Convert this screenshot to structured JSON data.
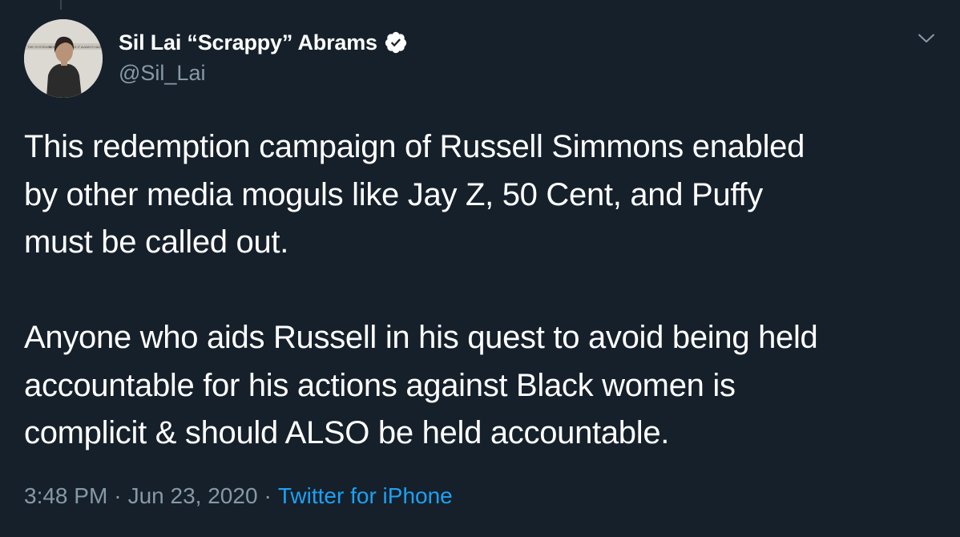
{
  "author": {
    "display_name": "Sil Lai “Scrappy” Abrams",
    "handle": "@Sil_Lai",
    "verified": true,
    "avatar_icon": "profile-photo"
  },
  "tweet": {
    "text": "This redemption campaign of Russell Simmons enabled\nby other media moguls like Jay Z, 50 Cent, and Puffy\nmust be called out.\n\nAnyone who aids Russell in his quest to avoid being held\naccountable for his actions against Black women is\ncomplicit & should ALSO be held accountable.",
    "time": "3:48 PM",
    "separator": "·",
    "date": "Jun 23, 2020",
    "source": "Twitter for iPhone"
  },
  "icons": {
    "verified": "verified-badge-icon",
    "menu": "chevron-down-icon"
  },
  "colors": {
    "background": "#15202b",
    "text": "#ffffff",
    "muted": "#8899a6",
    "link": "#1da1f2"
  }
}
